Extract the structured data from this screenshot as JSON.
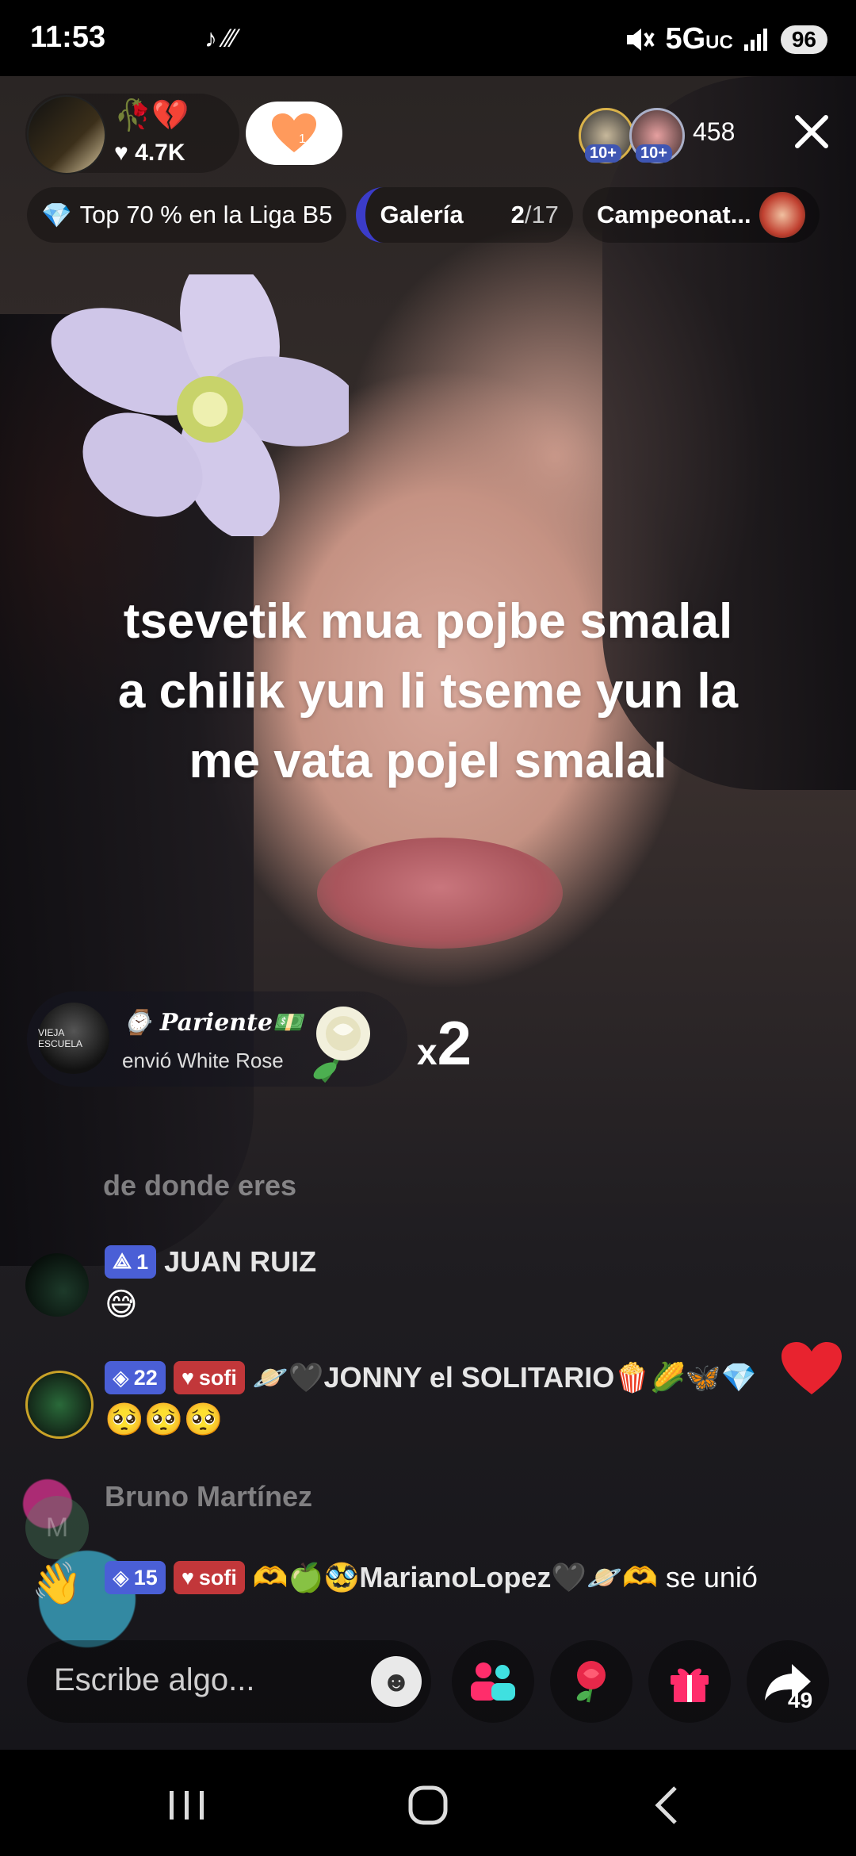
{
  "status_bar": {
    "time": "11:53",
    "app_icons": "♪ ⁄⁄⁄",
    "network": "5G",
    "network_sub": "UC",
    "battery": "96"
  },
  "host": {
    "emojis": "🥀💔",
    "likes": "4.7K"
  },
  "viewers": {
    "badges": [
      "10+",
      "10+"
    ],
    "count": "458"
  },
  "chips": {
    "league": "Top 70 % en la Liga B5",
    "gallery": "Galería",
    "gallery_index": "2",
    "gallery_total": "/17",
    "campaign": "Campeonat..."
  },
  "overlay_text": "tsevetik mua  pojbe smalal a chilik yun li tseme yun la me vata pojel smalal",
  "gift": {
    "sender": "Pariente",
    "sender_prefix": "⌚",
    "sender_suffix": "💵",
    "avatar_text": "VIEJA ESCUELA",
    "action": "envió White Rose",
    "multiplier_prefix": "x",
    "multiplier": "2"
  },
  "comments": [
    {
      "text": "de donde eres"
    },
    {
      "level": "1",
      "name": "JUAN RUIZ",
      "message": "😅"
    },
    {
      "level": "22",
      "fan_badge": "sofi",
      "name": "🪐🖤JONNY el SOLITARIO🍿🌽🦋💎",
      "message": "🥺🥺🥺"
    },
    {
      "name": "Bruno Martínez",
      "avatar_letter": "M"
    },
    {
      "level": "15",
      "fan_badge": "sofi",
      "name": "🫶🍏🥸MarianoLopez🖤🪐🫶",
      "action": "se unió"
    }
  ],
  "input": {
    "placeholder": "Escribe algo..."
  },
  "share": {
    "count": "49"
  },
  "colors": {
    "accent_pink": "#ff2d6b",
    "level_badge": "#4a5fd6",
    "fan_badge": "#c2373a",
    "follow_heart": "#ff9a5c"
  }
}
